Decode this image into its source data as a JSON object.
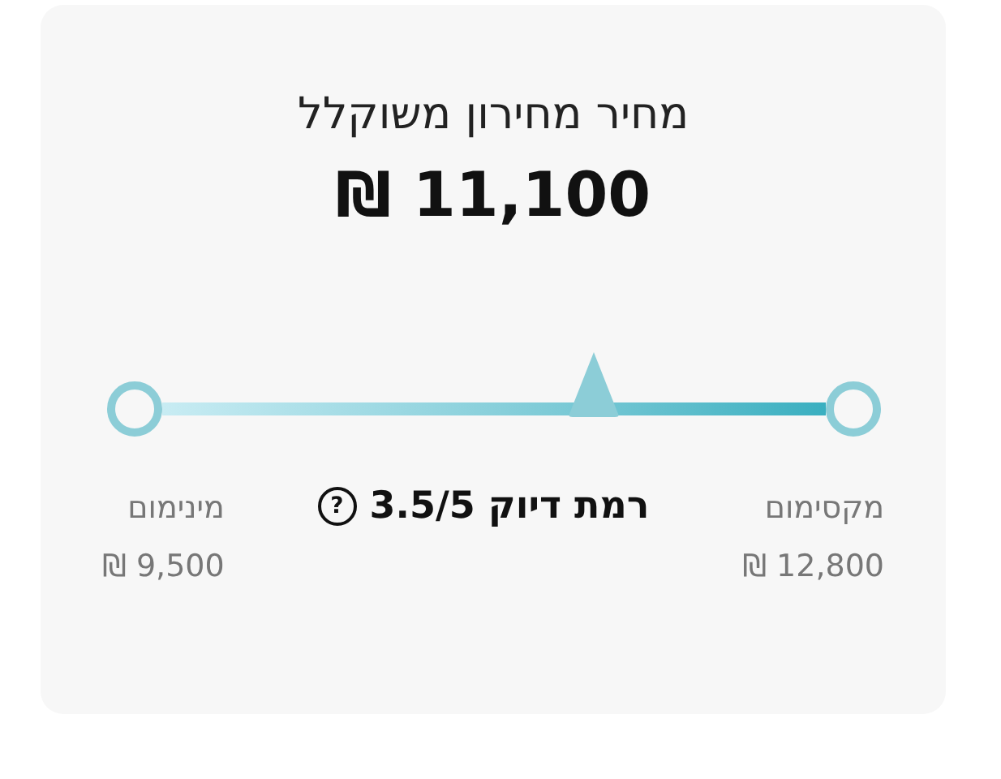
{
  "card": {
    "title": "מחיר מחירון משוקלל",
    "price": "11,100 ₪"
  },
  "slider": {
    "level": 0.65
  },
  "maximum": {
    "label": "מקסימום",
    "value": "12,800 ₪"
  },
  "accuracy": {
    "label": "רמת דיוק 3.5/5",
    "help": "?"
  },
  "minimum": {
    "label": "מינימום",
    "value": "9,500 ₪"
  }
}
